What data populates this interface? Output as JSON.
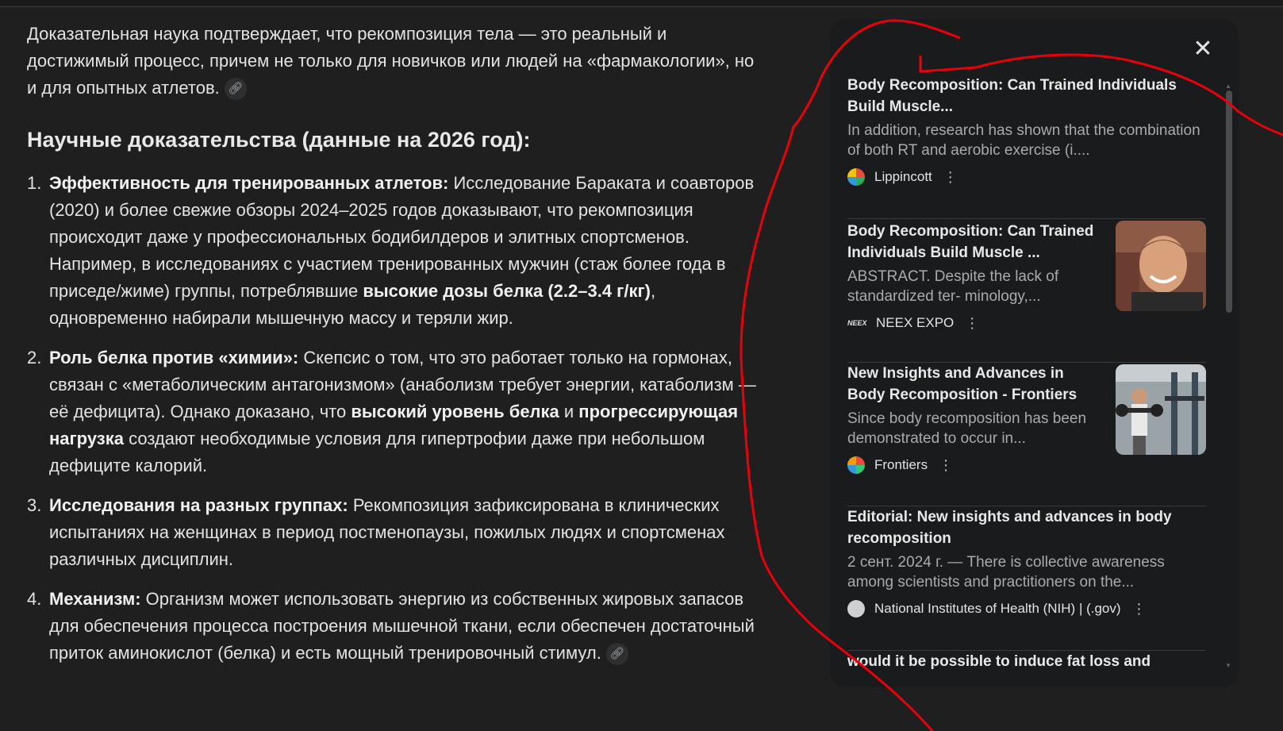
{
  "article": {
    "intro": "Доказательная наука подтверждает, что рекомпозиция тела — это реальный и достижимый процесс, причем не только для новичков или людей на «фармакологии», но и для опытных атлетов.",
    "heading": "Научные доказательства (данные на 2026 год):",
    "points": [
      {
        "num": "1.",
        "bold": "Эффективность для тренированных атлетов:",
        "text": " Исследование Бараката и соавторов (2020) и более свежие обзоры 2024–2025 годов доказывают, что рекомпозиция происходит даже у профессиональных бодибилдеров и элитных спортсменов. Например, в исследованиях с участием тренированных мужчин (стаж более года в приседе/жиме) группы, потреблявшие ",
        "bold2": "высокие дозы белка (2.2–3.4 г/кг)",
        "text2": ", одновременно набирали мышечную массу и теряли жир."
      },
      {
        "num": "2.",
        "bold": "Роль белка против «химии»:",
        "text": " Скепсис о том, что это работает только на гормонах, связан с «метаболическим антагонизмом» (анаболизм требует энергии, катаболизм — её дефицита). Однако доказано, что ",
        "bold2": "высокий уровень белка",
        "text2": " и ",
        "bold3": "прогрессирующая нагрузка",
        "text3": " создают необходимые условия для гипертрофии даже при небольшом дефиците калорий."
      },
      {
        "num": "3.",
        "bold": "Исследования на разных группах:",
        "text": " Рекомпозиция зафиксирована в клинических испытаниях на женщинах в период постменопаузы, пожилых людях и спортсменах различных дисциплин."
      },
      {
        "num": "4.",
        "bold": "Механизм:",
        "text": " Организм может использовать энергию из собственных жировых запасов для обеспечения процесса построения мышечной ткани, если обеспечен достаточный приток аминокислот (белка) и есть мощный тренировочный стимул."
      }
    ],
    "link_icon": "link-icon"
  },
  "panel": {
    "close_icon": "close-icon",
    "more_label": "⋮",
    "sources": [
      {
        "title": "Body Recomposition: Can Trained Individuals Build Muscle...",
        "snippet": "In addition, research has shown that the combination of both RT and aerobic exercise (i....",
        "source": "Lippincott",
        "favicon": "lippincott-favicon"
      },
      {
        "title": "Body Recomposition: Can Trained Individuals Build Muscle ...",
        "snippet": "ABSTRACT. Despite the lack of standardized ter- minology,...",
        "source": "NEEX EXPO",
        "favicon_text": "NEEX",
        "thumbnail": "man-portrait-thumbnail"
      },
      {
        "title": "New Insights and Advances in Body Recomposition - Frontiers",
        "snippet": "Since body recomposition has been demonstrated to occur in...",
        "source": "Frontiers",
        "favicon": "frontiers-favicon",
        "thumbnail": "gym-thumbnail"
      },
      {
        "title": "Editorial: New insights and advances in body recomposition",
        "snippet": "2 сент. 2024 г. — There is collective awareness among scientists and practitioners on the...",
        "source": "National Institutes of Health (NIH) | (.gov)",
        "favicon": "nih-favicon"
      },
      {
        "title": "would it be possible to induce fat loss and"
      }
    ]
  },
  "colors": {
    "background": "#1f1f1f",
    "panel": "#1a1b1c",
    "annotation_stroke": "#e8000b"
  }
}
